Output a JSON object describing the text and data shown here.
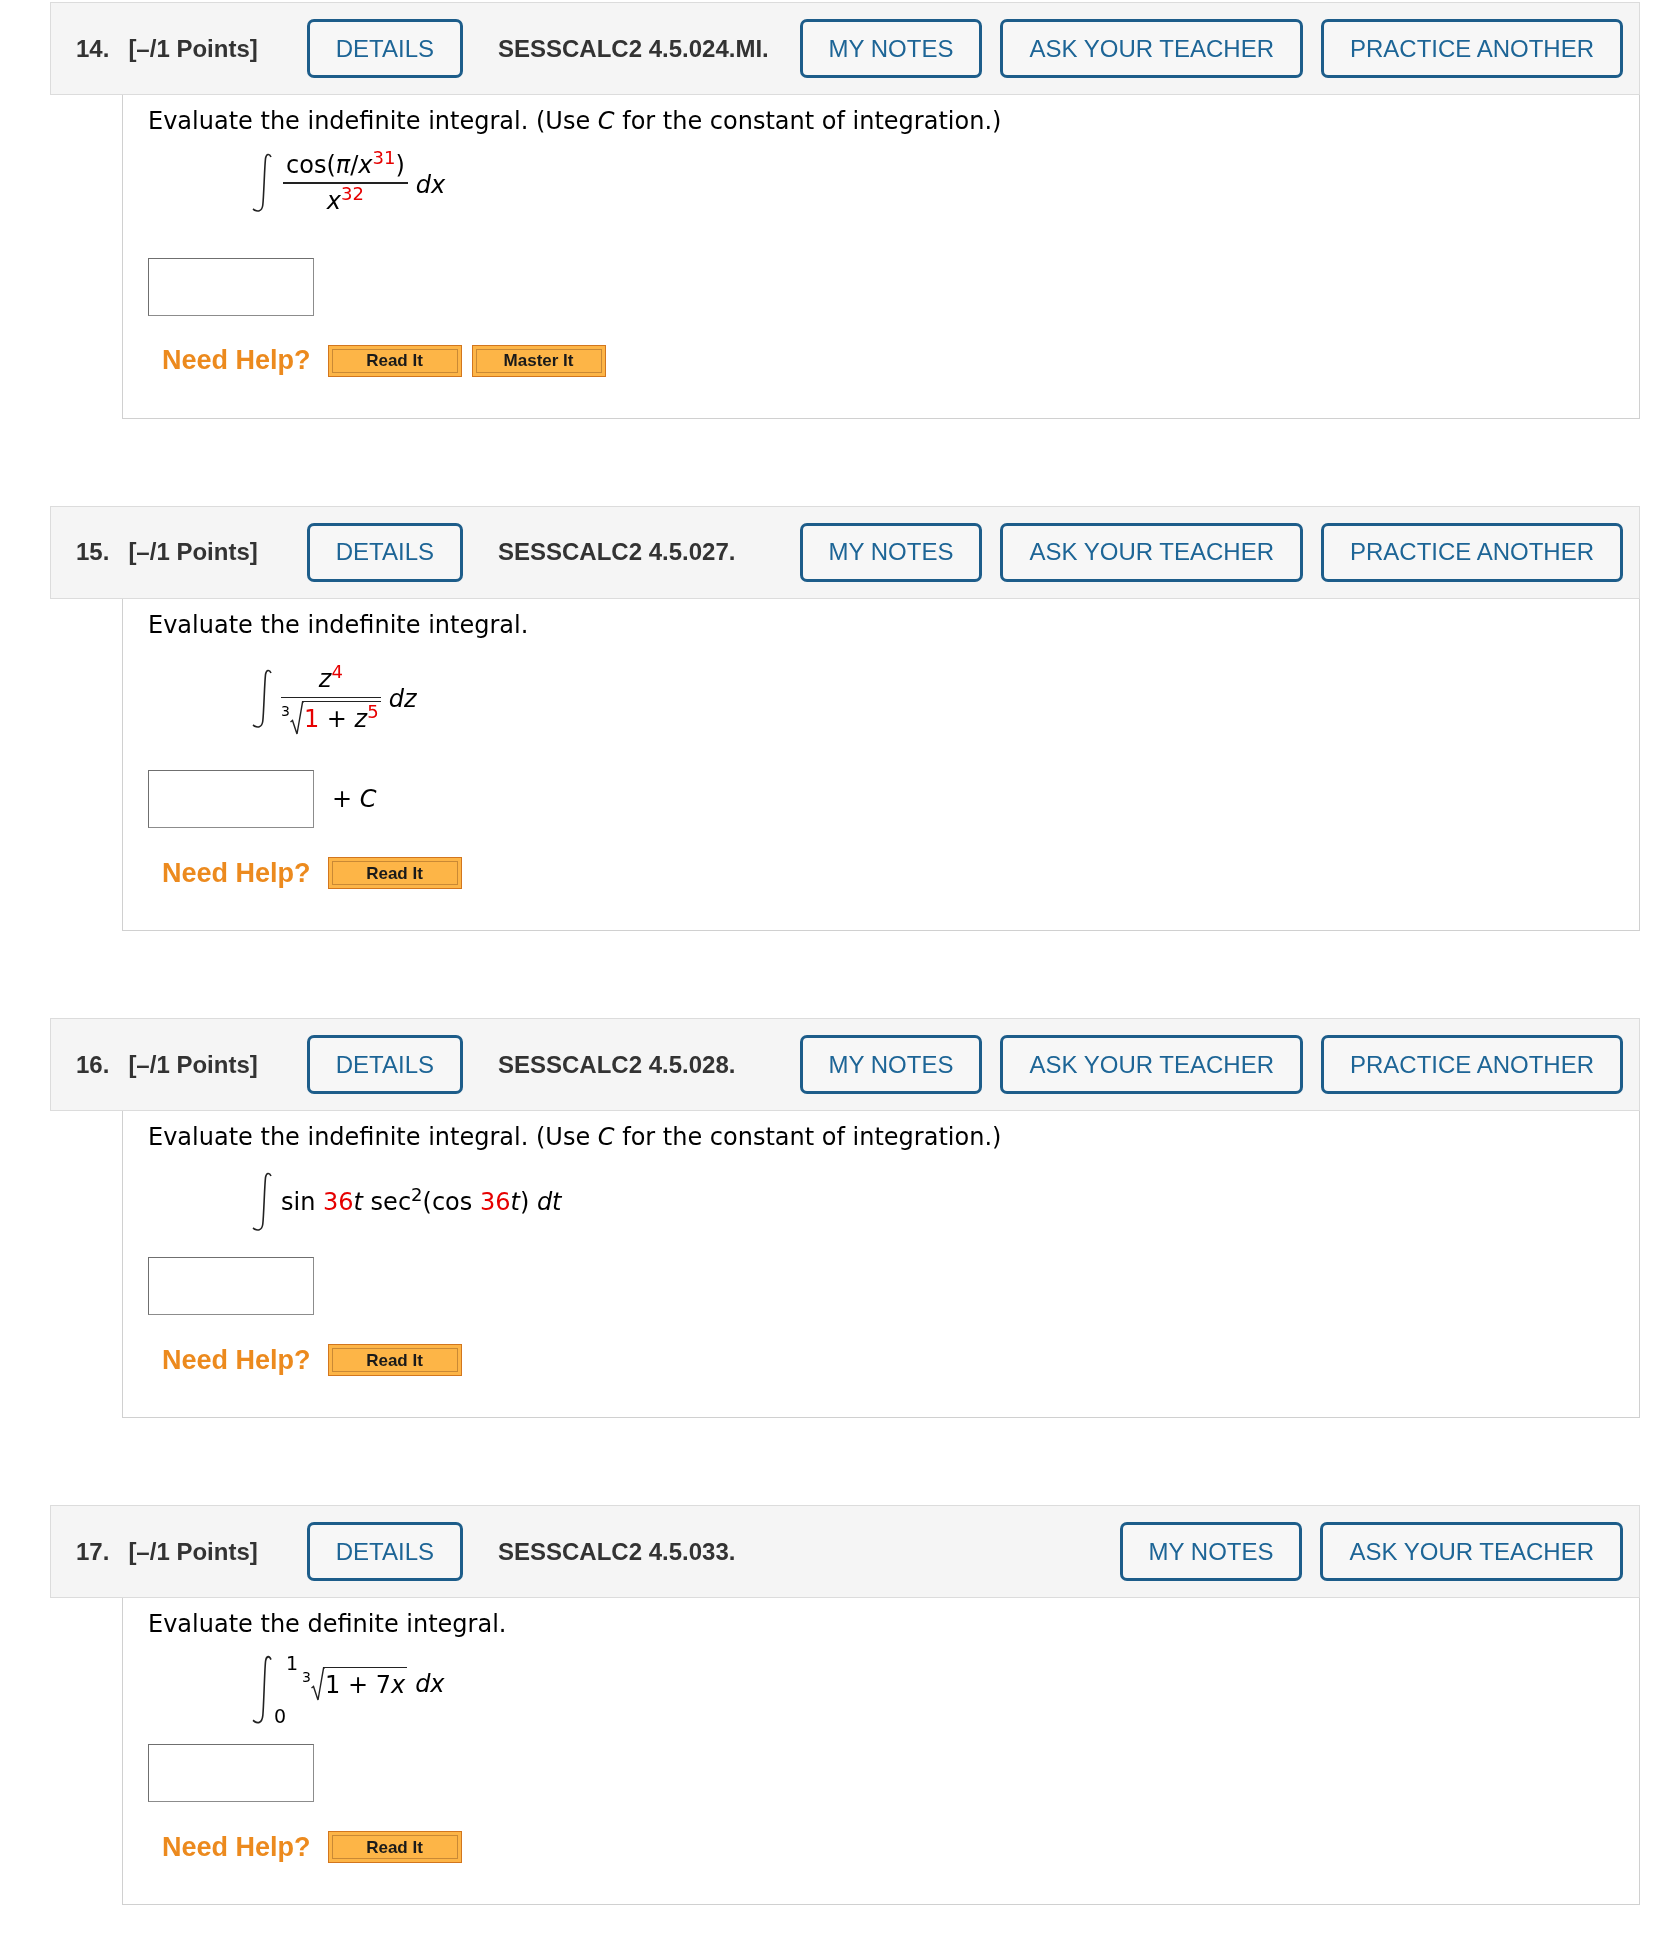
{
  "problems": [
    {
      "header": {
        "number": "14.",
        "points": "[–/1 Points]",
        "details": "DETAILS",
        "code": "SESSCALC2 4.5.024.MI.",
        "actions": [
          "MY NOTES",
          "ASK YOUR TEACHER",
          "PRACTICE ANOTHER"
        ]
      },
      "prompt": "Evaluate the indefinite integral. (Use *C* for the constant of integration.)",
      "integral": {
        "kind": "fraction",
        "numerator": [
          {
            "text": "cos(*π*/*x*",
            "color": "#000000"
          },
          {
            "text": "$^{31}$",
            "color": "#e60000"
          },
          {
            "text": ")",
            "color": "#000000"
          }
        ],
        "denominator": [
          {
            "text": "*x*",
            "color": "#000000"
          },
          {
            "text": "$^{32}$",
            "color": "#e60000"
          }
        ],
        "differential": "dx"
      },
      "answer": {
        "kind": "blank"
      },
      "help": {
        "label": "Need Help?",
        "buttons": [
          "Read It",
          "Master It"
        ]
      }
    },
    {
      "header": {
        "number": "15.",
        "points": "[–/1 Points]",
        "details": "DETAILS",
        "code": "SESSCALC2 4.5.027.",
        "actions": [
          "MY NOTES",
          "ASK YOUR TEACHER",
          "PRACTICE ANOTHER"
        ]
      },
      "prompt": "Evaluate the indefinite integral.",
      "integral": {
        "kind": "root_fraction",
        "numerator": [
          {
            "text": "*z*",
            "color": "#000000"
          },
          {
            "text": "$^{4}$",
            "color": "#e60000"
          }
        ],
        "index": "3",
        "radicand": [
          {
            "text": "1",
            "color": "#e60000"
          },
          {
            "text": " + *z*",
            "color": "#000000"
          },
          {
            "text": "$^{5}$",
            "color": "#e60000"
          }
        ],
        "differential": "dz"
      },
      "answer": {
        "kind": "blank",
        "suffix": "+ *C*"
      },
      "help": {
        "label": "Need Help?",
        "buttons": [
          "Read It"
        ]
      }
    },
    {
      "header": {
        "number": "16.",
        "points": "[–/1 Points]",
        "details": "DETAILS",
        "code": "SESSCALC2 4.5.028.",
        "actions": [
          "MY NOTES",
          "ASK YOUR TEACHER",
          "PRACTICE ANOTHER"
        ]
      },
      "prompt": "Evaluate the indefinite integral. (Use *C* for the constant of integration.)",
      "integral": {
        "kind": "inline",
        "expression": [
          {
            "text": "sin ",
            "color": "#000000"
          },
          {
            "text": "36",
            "color": "#e60000"
          },
          {
            "text": "*t* sec$^{2}$(cos ",
            "color": "#000000"
          },
          {
            "text": "36",
            "color": "#e60000"
          },
          {
            "text": "*t*) *dt*",
            "color": "#000000"
          }
        ]
      },
      "answer": {
        "kind": "blank"
      },
      "help": {
        "label": "Need Help?",
        "buttons": [
          "Read It"
        ]
      }
    },
    {
      "header": {
        "number": "17.",
        "points": "[–/1 Points]",
        "details": "DETAILS",
        "code": "SESSCALC2 4.5.033.",
        "actions": [
          "MY NOTES",
          "ASK YOUR TEACHER"
        ]
      },
      "prompt": "Evaluate the definite integral.",
      "integral": {
        "kind": "definite_root",
        "upper": "1",
        "lower": "0",
        "index": "3",
        "radicand": [
          {
            "text": "1 + 7",
            "color": "#000000"
          },
          {
            "text": "*x*",
            "color": "#000000"
          }
        ],
        "differential": "dx"
      },
      "answer": {
        "kind": "blank"
      },
      "help": {
        "label": "Need Help?",
        "buttons": [
          "Read It"
        ]
      }
    }
  ]
}
